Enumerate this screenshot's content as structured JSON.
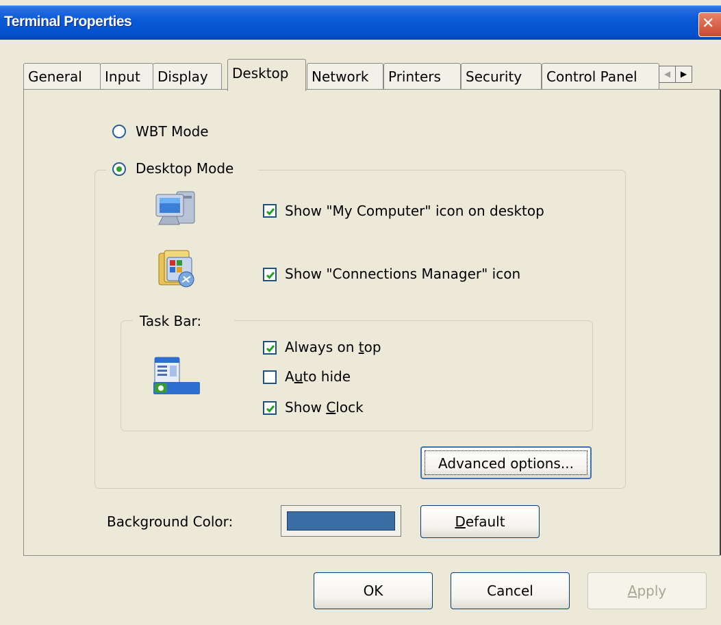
{
  "window": {
    "title": "Terminal Properties",
    "close_glyph": "✕"
  },
  "tabs": [
    {
      "label": "General"
    },
    {
      "label": "Input"
    },
    {
      "label": "Display"
    },
    {
      "label": "Desktop",
      "active": true
    },
    {
      "label": "Network"
    },
    {
      "label": "Printers"
    },
    {
      "label": "Security"
    },
    {
      "label": "Control Panel"
    }
  ],
  "tab_scroll": {
    "left_glyph": "◀",
    "right_glyph": "▶"
  },
  "mode": {
    "wbt_label": "WBT Mode",
    "desktop_label": "Desktop Mode",
    "selected": "Desktop Mode"
  },
  "desktop_options": {
    "show_my_computer": {
      "label": "Show \"My Computer\" icon on desktop",
      "checked": true
    },
    "show_connections": {
      "label": "Show \"Connections Manager\" icon",
      "checked": true
    }
  },
  "taskbar": {
    "group_label": "Task Bar:",
    "always_on_top": {
      "label_pre": "Always on ",
      "label_u": "t",
      "label_post": "op",
      "checked": true
    },
    "auto_hide": {
      "label_pre": "A",
      "label_u": "u",
      "label_post": "to hide",
      "checked": false
    },
    "show_clock": {
      "label_pre": "Show ",
      "label_u": "C",
      "label_post": "lock",
      "checked": true
    }
  },
  "advanced_button": "Advanced options...",
  "background": {
    "label": "Background Color:",
    "color": "#3a6ea5",
    "default_u": "D",
    "default_rest": "efault"
  },
  "footer": {
    "ok": "OK",
    "cancel": "Cancel",
    "apply_u": "A",
    "apply_rest": "pply"
  },
  "icons": [
    "my-computer-icon",
    "connections-manager-icon",
    "taskbar-icon"
  ]
}
